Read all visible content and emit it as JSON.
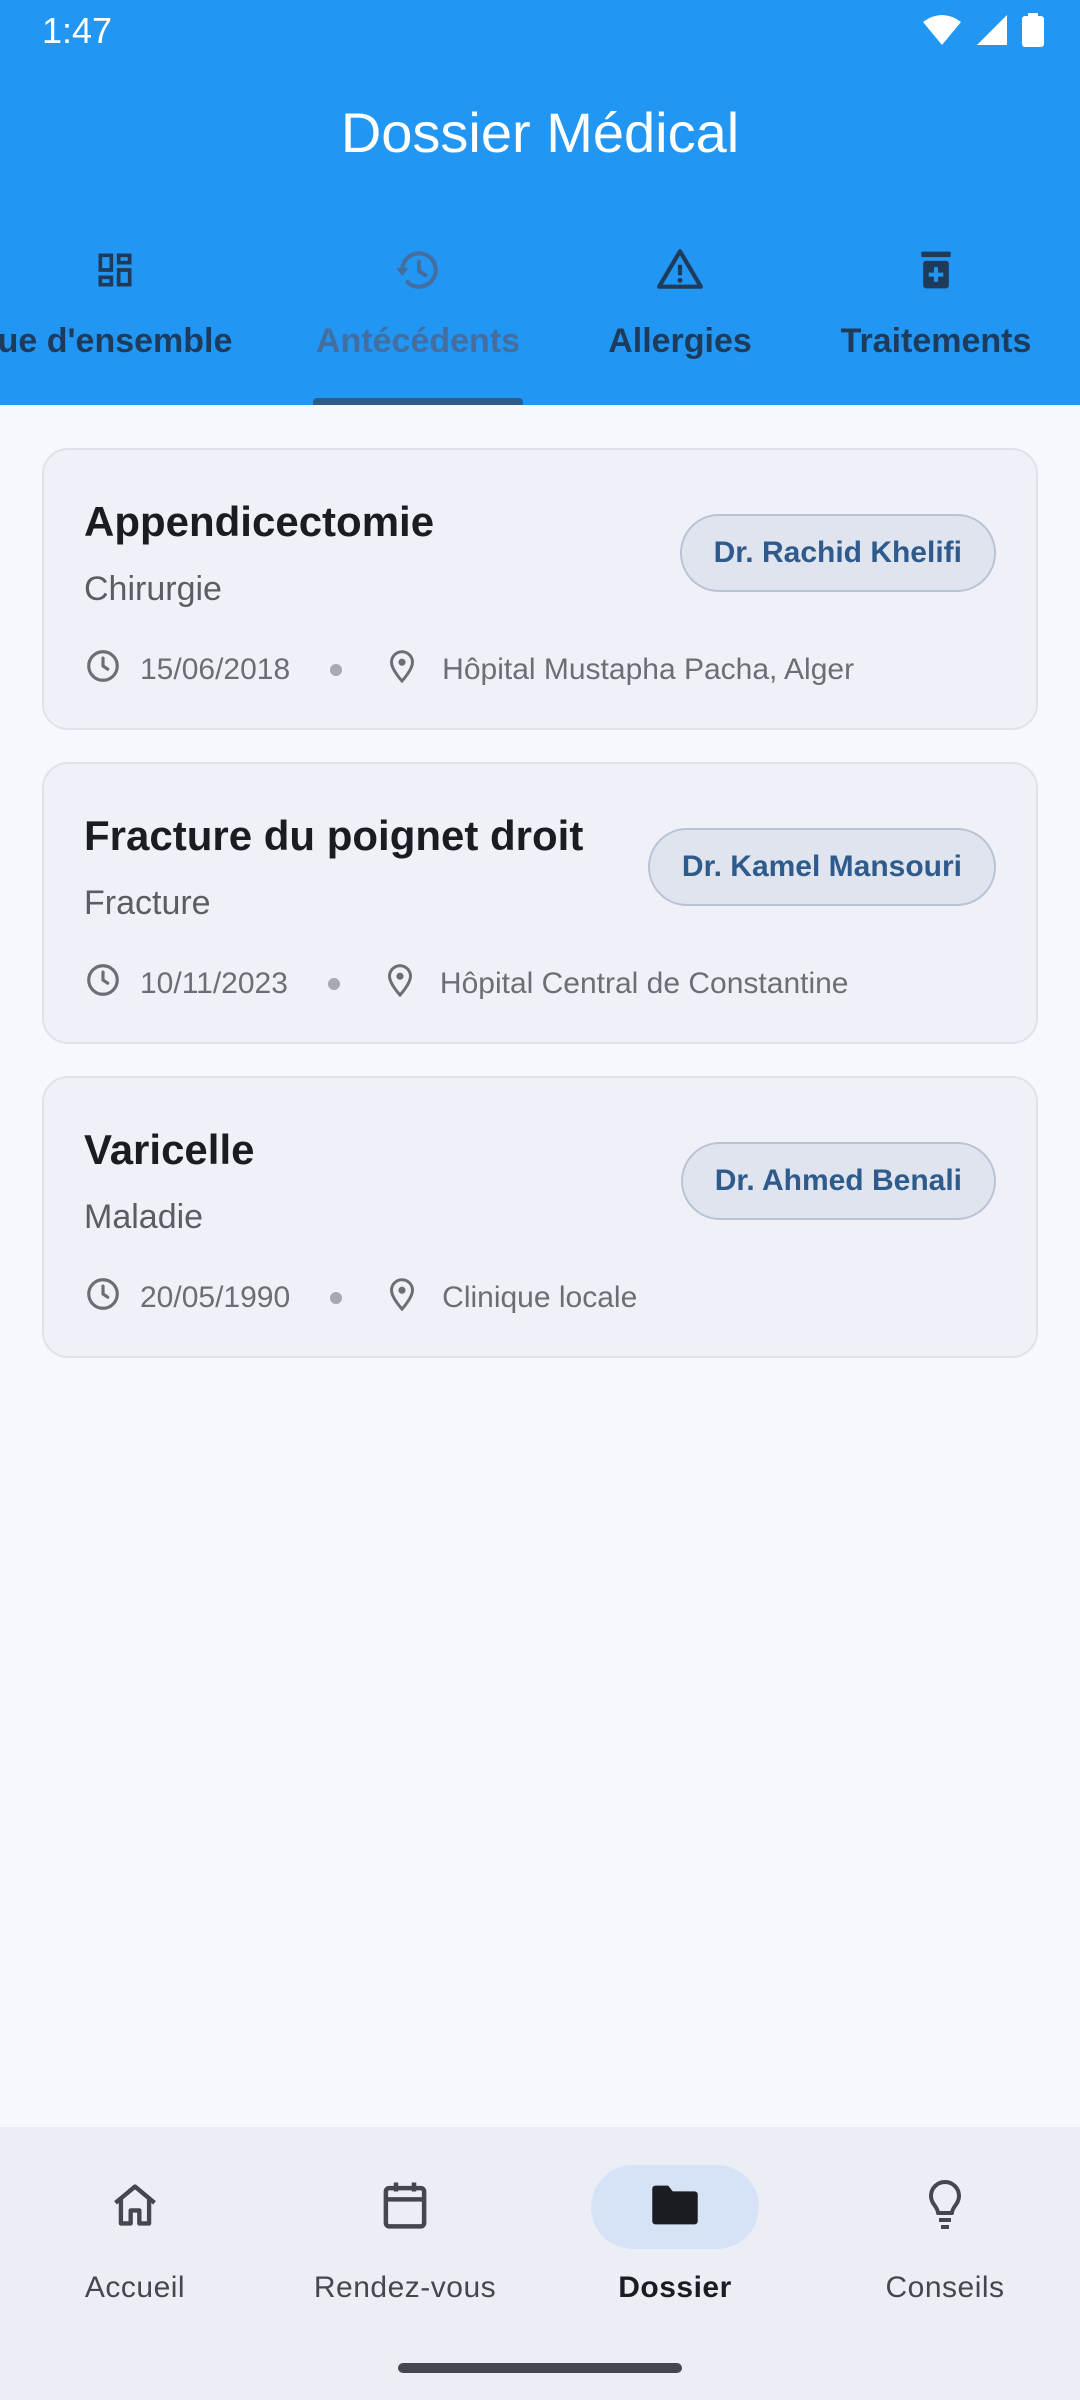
{
  "status_bar": {
    "time": "1:47"
  },
  "app_bar": {
    "title": "Dossier Médical"
  },
  "tabs": [
    {
      "label": "ue d'ensemble",
      "icon": "dashboard-icon"
    },
    {
      "label": "Antécédents",
      "icon": "history-icon",
      "active": true
    },
    {
      "label": "Allergies",
      "icon": "warning-icon"
    },
    {
      "label": "Traitements",
      "icon": "medication-icon"
    }
  ],
  "records": [
    {
      "title": "Appendicectomie",
      "type": "Chirurgie",
      "doctor": "Dr. Rachid Khelifi",
      "date": "15/06/2018",
      "place": "Hôpital Mustapha Pacha, Alger"
    },
    {
      "title": "Fracture du poignet droit",
      "type": "Fracture",
      "doctor": "Dr. Kamel Mansouri",
      "date": "10/11/2023",
      "place": "Hôpital Central de Constantine"
    },
    {
      "title": "Varicelle",
      "type": "Maladie",
      "doctor": "Dr. Ahmed Benali",
      "date": "20/05/1990",
      "place": "Clinique locale"
    }
  ],
  "bottom_nav": [
    {
      "label": "Accueil",
      "icon": "home-icon"
    },
    {
      "label": "Rendez-vous",
      "icon": "calendar-icon"
    },
    {
      "label": "Dossier",
      "icon": "folder-icon",
      "active": true
    },
    {
      "label": "Conseils",
      "icon": "lightbulb-icon"
    }
  ],
  "colors": {
    "app_bar": "#2196f3",
    "tab_indicator": "#2e5b8c",
    "chip_text": "#2e5b8c",
    "card_background": "#f0f1f8",
    "nav_active_pill": "#d6e3f6"
  }
}
